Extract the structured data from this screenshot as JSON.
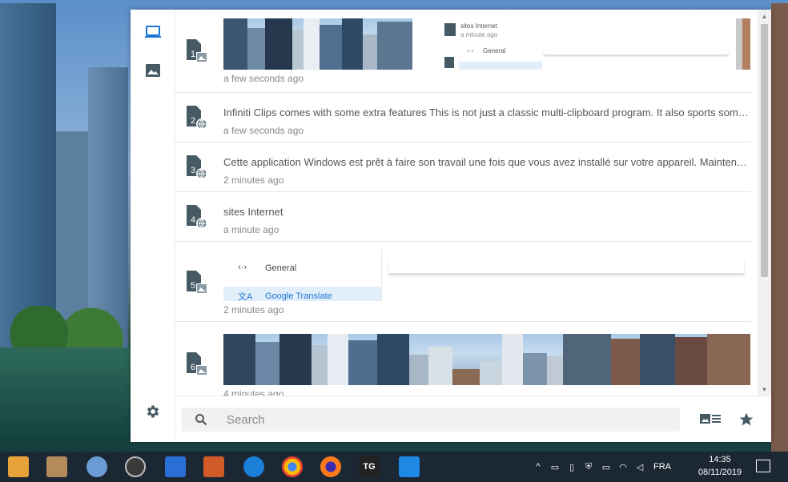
{
  "clips": [
    {
      "index": "1",
      "kind": "image",
      "time": "a few seconds ago",
      "preview_text": [
        "sites Internet",
        "a minute ago",
        "General"
      ]
    },
    {
      "index": "2",
      "kind": "web",
      "time": "a few seconds ago",
      "text": "Infiniti Clips comes with some extra features  This is not just a classic multi-clipboard program. It also sports some clever features"
    },
    {
      "index": "3",
      "kind": "web",
      "time": "2 minutes ago",
      "text": "Cette application Windows est prêt à faire son travail une fois que vous avez installé sur votre appareil. Maintenant, vous pouvez"
    },
    {
      "index": "4",
      "kind": "web",
      "time": "a minute ago",
      "text": "sites Internet"
    },
    {
      "index": "5",
      "kind": "image",
      "time": "2 minutes ago",
      "preview_text": [
        "General",
        "Google Translate"
      ]
    },
    {
      "index": "6",
      "kind": "image",
      "time": "4 minutes ago"
    }
  ],
  "search": {
    "placeholder": "Search"
  },
  "taskbar": {
    "language": "FRA",
    "time": "14:35",
    "date": "08/11/2019"
  },
  "colors": {
    "accent": "#1976d2",
    "icon": "#455a64",
    "text": "#555555",
    "muted": "#888888"
  },
  "icons": {
    "rail": [
      "clips-icon",
      "images-icon",
      "settings-icon"
    ],
    "bottom": [
      "search-icon",
      "gallery-view-icon",
      "favorites-star-icon"
    ]
  }
}
